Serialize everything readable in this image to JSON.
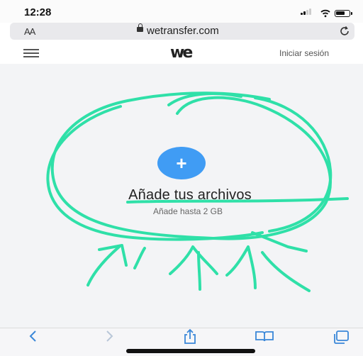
{
  "status_bar": {
    "time": "12:28"
  },
  "browser": {
    "text_size_label": "AA",
    "domain": "wetransfer.com",
    "reload_icon": "reload-icon",
    "toolbar_icons": [
      "back-icon",
      "forward-icon",
      "share-icon",
      "bookmarks-icon",
      "tabs-icon"
    ]
  },
  "header": {
    "logo": "we",
    "login_label": "Iniciar sesión"
  },
  "upload": {
    "button_icon": "plus-icon",
    "title": "Añade tus archivos",
    "subtitle": "Añade hasta 2 GB"
  },
  "colors": {
    "accent": "#409cf4",
    "annotation": "#2fe0a8",
    "background": "#f3f4f6"
  }
}
